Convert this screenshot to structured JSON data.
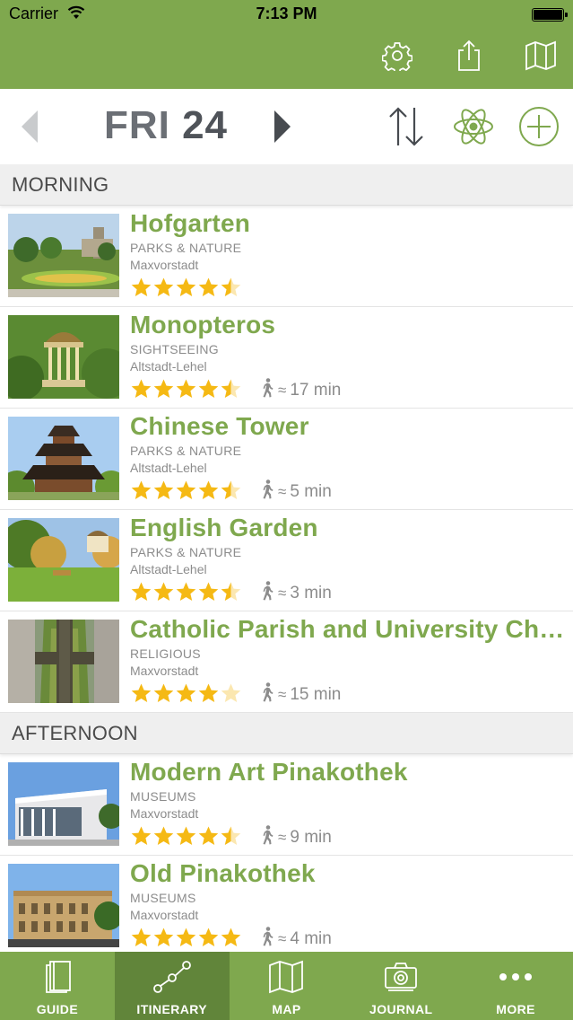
{
  "status_bar": {
    "carrier": "Carrier",
    "time": "7:13 PM"
  },
  "toolbar": {
    "icons": [
      "gear-icon",
      "share-icon",
      "map-icon"
    ]
  },
  "day_selector": {
    "weekday": "FRI",
    "day": "24"
  },
  "sections": [
    {
      "title": "MORNING",
      "items": [
        {
          "title": "Hofgarten",
          "category": "PARKS & NATURE",
          "area": "Maxvorstadt",
          "rating": 4.5,
          "walk": ""
        },
        {
          "title": "Monopteros",
          "category": "SIGHTSEEING",
          "area": "Altstadt-Lehel",
          "rating": 4.5,
          "walk": "17 min"
        },
        {
          "title": "Chinese Tower",
          "category": "PARKS & NATURE",
          "area": "Altstadt-Lehel",
          "rating": 4.5,
          "walk": "5 min"
        },
        {
          "title": "English Garden",
          "category": "PARKS & NATURE",
          "area": "Altstadt-Lehel",
          "rating": 4.5,
          "walk": "3 min"
        },
        {
          "title": "Catholic Parish and University Church St. L...",
          "category": "RELIGIOUS",
          "area": "Maxvorstadt",
          "rating": 4,
          "walk": "15 min"
        }
      ]
    },
    {
      "title": "AFTERNOON",
      "items": [
        {
          "title": "Modern Art Pinakothek",
          "category": "MUSEUMS",
          "area": "Maxvorstadt",
          "rating": 4.5,
          "walk": "9 min"
        },
        {
          "title": "Old Pinakothek",
          "category": "MUSEUMS",
          "area": "Maxvorstadt",
          "rating": 5,
          "walk": "4 min"
        }
      ]
    }
  ],
  "walk_prefix": "≈",
  "tabs": [
    {
      "label": "GUIDE",
      "icon": "guide-icon"
    },
    {
      "label": "ITINERARY",
      "icon": "itinerary-icon",
      "active": true
    },
    {
      "label": "MAP",
      "icon": "map-icon"
    },
    {
      "label": "JOURNAL",
      "icon": "camera-icon"
    },
    {
      "label": "MORE",
      "icon": "more-icon"
    }
  ],
  "colors": {
    "brand_green": "#7fa84e",
    "active_tab": "#61853a",
    "star": "#f5b914",
    "section_bg": "#efefef"
  }
}
